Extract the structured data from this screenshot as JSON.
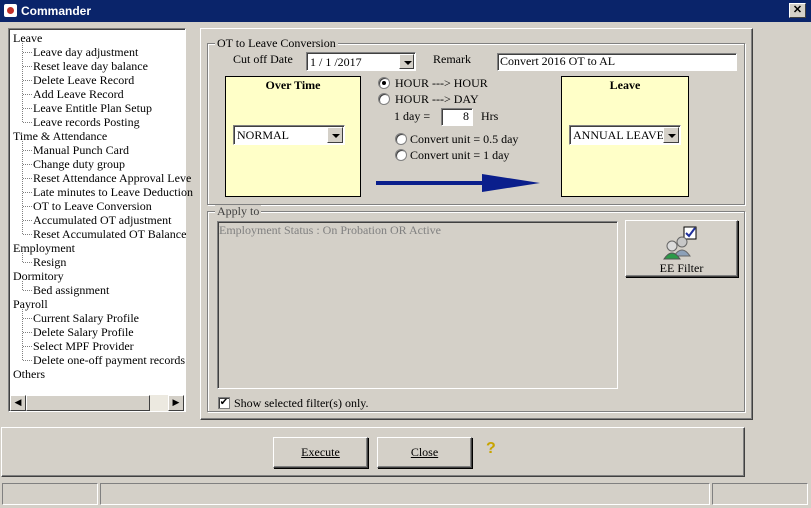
{
  "window": {
    "title": "Commander",
    "close_glyph": "✕"
  },
  "tree": {
    "items": [
      {
        "label": "Leave",
        "level": 0
      },
      {
        "label": "Leave day adjustment",
        "level": 1
      },
      {
        "label": "Reset leave day balance",
        "level": 1
      },
      {
        "label": "Delete Leave Record",
        "level": 1
      },
      {
        "label": "Add Leave Record",
        "level": 1
      },
      {
        "label": "Leave Entitle Plan Setup",
        "level": 1
      },
      {
        "label": "Leave records Posting",
        "level": 1
      },
      {
        "label": "Time & Attendance",
        "level": 0
      },
      {
        "label": "Manual Punch Card",
        "level": 1
      },
      {
        "label": "Change duty group",
        "level": 1
      },
      {
        "label": "Reset Attendance Approval Leve",
        "level": 1
      },
      {
        "label": "Late minutes to Leave Deduction",
        "level": 1
      },
      {
        "label": "OT to Leave Conversion",
        "level": 1
      },
      {
        "label": "Accumulated OT adjustment",
        "level": 1
      },
      {
        "label": "Reset Accumulated OT Balance",
        "level": 1
      },
      {
        "label": "Employment",
        "level": 0
      },
      {
        "label": "Resign",
        "level": 1
      },
      {
        "label": "Dormitory",
        "level": 0
      },
      {
        "label": "Bed assignment",
        "level": 1
      },
      {
        "label": "Payroll",
        "level": 0
      },
      {
        "label": "Current Salary Profile",
        "level": 1
      },
      {
        "label": "Delete Salary Profile",
        "level": 1
      },
      {
        "label": "Select MPF Provider",
        "level": 1
      },
      {
        "label": "Delete one-off payment records",
        "level": 1
      },
      {
        "label": "Others",
        "level": 0
      }
    ]
  },
  "ot_conversion": {
    "legend": "OT to Leave Conversion",
    "cutoff_label": "Cut off Date",
    "cutoff_value": "1 / 1 /2017",
    "remark_label": "Remark",
    "remark_value": "Convert 2016 OT to AL",
    "overtime_title": "Over Time",
    "overtime_value": "NORMAL",
    "leave_title": "Leave",
    "leave_value": "ANNUAL LEAVE",
    "radio_hour_hour": "HOUR ---> HOUR",
    "radio_hour_day": "HOUR ---> DAY",
    "one_day_label": "1 day =",
    "one_day_value": "8",
    "hrs_label": "Hrs",
    "convert_half": "Convert unit = 0.5 day",
    "convert_one": "Convert unit = 1 day",
    "arrow_color": "#0a1e8c"
  },
  "apply_to": {
    "legend": "Apply to",
    "filter_text": "Employment Status : On Probation OR Active",
    "ee_filter_label": "EE Filter",
    "show_selected_label": "Show selected filter(s) only."
  },
  "footer": {
    "execute_label": "Execute",
    "close_label": "Close",
    "help_glyph": "?"
  }
}
